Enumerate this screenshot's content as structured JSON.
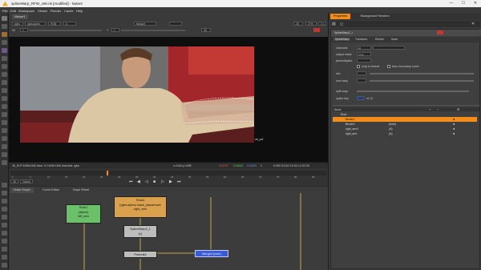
{
  "window": {
    "title": "splineWarp_RFW_v06.nk [modified] - NukeX",
    "minimize": "—",
    "maximize": "☐",
    "close": "✕"
  },
  "menu": [
    "File",
    "Edit",
    "Workspace",
    "Viewer",
    "Render",
    "Cache",
    "Help"
  ],
  "viewer": {
    "tab": "Viewer1",
    "layer": "rgba",
    "channel": "rgba.alpha",
    "colorspace": "RGB",
    "a_input": "A",
    "b_input": "Merge4",
    "gain_label": "f/8",
    "gain_value": "1",
    "gamma_label": "Y",
    "gamma_value": "1",
    "frame_value": "35",
    "fps": "2D",
    "zoom": "27%",
    "dim": "1:1",
    "overlay_label": "nk_pcf",
    "info_left": "4K_DCP 4096x2160 bbox: 0 0 4096 2160 channels: rgba",
    "info_mid": "x=1164 y=1395",
    "info_r": "0.01707",
    "info_g": "0.01643",
    "info_b": "0.01625",
    "info_a": "1",
    "info_right": "H:350 S:0.04 V:0.02 L:0.01720"
  },
  "timeline": {
    "frame": "35",
    "mode": "Global",
    "ticks": [
      "1",
      "5",
      "10",
      "15",
      "20",
      "25",
      "30",
      "35",
      "40",
      "45",
      "50",
      "55",
      "60",
      "65",
      "70",
      "75",
      "80",
      "85"
    ]
  },
  "nodegraph": {
    "tabs": [
      "Node Graph",
      "Curve Editor",
      "Dope Sheet"
    ],
    "nodes": {
      "roto1": "Roto1\n(alpha)\nleft_arm",
      "roto4": "Roto4\n(rgba.alpha) mask_planartrack\nright_arm",
      "splinewarp": "SplineWarp3_1\n(1)",
      "premult": "Premult4",
      "merge": "Merge4 (over)"
    }
  },
  "properties": {
    "tabs": [
      "Properties",
      "Background Renders"
    ],
    "node_name": "SplineWarp3_1",
    "subtabs": [
      "SplineWarp",
      "Transform",
      "Render",
      "Node"
    ],
    "rows": {
      "channels": "channels",
      "channels_val": "all",
      "output": "output mask",
      "output_val": "none",
      "premult": "premultiplied",
      "crop": "crop to format",
      "bbox": "bbox boundary curve",
      "mix": "mix",
      "root_warp": "root warp",
      "split_warp": "split warp",
      "spline_key": "spline key",
      "spline_key_val": "of 12"
    },
    "table_header": [
      "Name",
      "",
      "",
      "",
      "",
      "",
      ""
    ],
    "table_rows": [
      {
        "name": "Root",
        "col2": "",
        "selected": false
      },
      {
        "name": "Bezier1",
        "col2": "",
        "selected": true
      },
      {
        "name": "Bezier2",
        "col2": "(both)",
        "selected": false
      },
      {
        "name": "right_arm1",
        "col2": "(A)",
        "selected": false
      },
      {
        "name": "right_arm",
        "col2": "(A)",
        "selected": false
      }
    ]
  },
  "colors": {
    "accent": "#f28c1a",
    "roto": "#6cc06a",
    "roto4": "#d9a04e",
    "merge": "#3a5bd8",
    "gray_node": "#bdbdbd"
  }
}
